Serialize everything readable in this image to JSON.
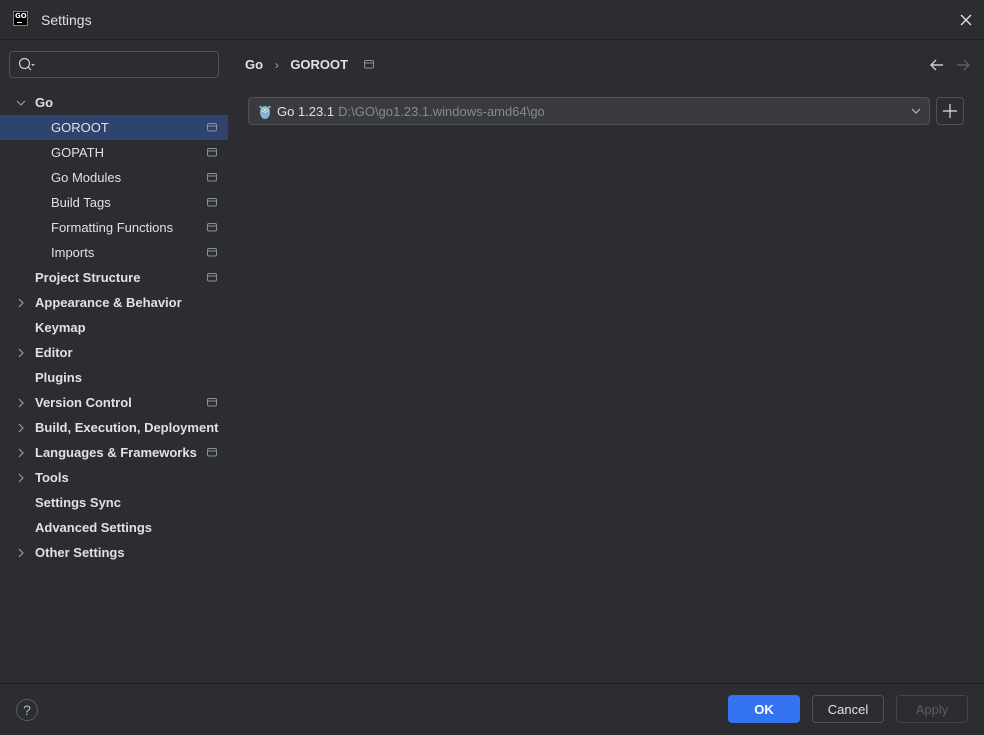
{
  "window": {
    "title": "Settings",
    "logo_text": "GO",
    "icons": {
      "logo": "goland-logo-icon",
      "close": "close-icon"
    }
  },
  "sidebar": {
    "search": {
      "value": "",
      "placeholder": "",
      "icon": "search-icon"
    },
    "items": [
      {
        "label": "Go",
        "level": 0,
        "bold": true,
        "expandable": true,
        "expanded": true,
        "project_icon": false,
        "selected": false
      },
      {
        "label": "GOROOT",
        "level": 1,
        "bold": false,
        "expandable": false,
        "project_icon": true,
        "selected": true
      },
      {
        "label": "GOPATH",
        "level": 1,
        "bold": false,
        "expandable": false,
        "project_icon": true,
        "selected": false
      },
      {
        "label": "Go Modules",
        "level": 1,
        "bold": false,
        "expandable": false,
        "project_icon": true,
        "selected": false
      },
      {
        "label": "Build Tags",
        "level": 1,
        "bold": false,
        "expandable": false,
        "project_icon": true,
        "selected": false
      },
      {
        "label": "Formatting Functions",
        "level": 1,
        "bold": false,
        "expandable": false,
        "project_icon": true,
        "selected": false
      },
      {
        "label": "Imports",
        "level": 1,
        "bold": false,
        "expandable": false,
        "project_icon": true,
        "selected": false
      },
      {
        "label": "Project Structure",
        "level": 0,
        "bold": true,
        "expandable": false,
        "project_icon": true,
        "selected": false
      },
      {
        "label": "Appearance & Behavior",
        "level": 0,
        "bold": true,
        "expandable": true,
        "expanded": false,
        "project_icon": false,
        "selected": false
      },
      {
        "label": "Keymap",
        "level": 0,
        "bold": true,
        "expandable": false,
        "project_icon": false,
        "selected": false
      },
      {
        "label": "Editor",
        "level": 0,
        "bold": true,
        "expandable": true,
        "expanded": false,
        "project_icon": false,
        "selected": false
      },
      {
        "label": "Plugins",
        "level": 0,
        "bold": true,
        "expandable": false,
        "project_icon": false,
        "selected": false
      },
      {
        "label": "Version Control",
        "level": 0,
        "bold": true,
        "expandable": true,
        "expanded": false,
        "project_icon": true,
        "selected": false
      },
      {
        "label": "Build, Execution, Deployment",
        "level": 0,
        "bold": true,
        "expandable": true,
        "expanded": false,
        "project_icon": false,
        "selected": false
      },
      {
        "label": "Languages & Frameworks",
        "level": 0,
        "bold": true,
        "expandable": true,
        "expanded": false,
        "project_icon": true,
        "selected": false
      },
      {
        "label": "Tools",
        "level": 0,
        "bold": true,
        "expandable": true,
        "expanded": false,
        "project_icon": false,
        "selected": false
      },
      {
        "label": "Settings Sync",
        "level": 0,
        "bold": true,
        "expandable": false,
        "project_icon": false,
        "selected": false
      },
      {
        "label": "Advanced Settings",
        "level": 0,
        "bold": true,
        "expandable": false,
        "project_icon": false,
        "selected": false
      },
      {
        "label": "Other Settings",
        "level": 0,
        "bold": true,
        "expandable": true,
        "expanded": false,
        "project_icon": false,
        "selected": false
      }
    ]
  },
  "main": {
    "breadcrumb": {
      "parent": "Go",
      "separator": "›",
      "current": "GOROOT"
    },
    "sdk": {
      "name": "Go 1.23.1",
      "path": "D:\\GO\\go1.23.1.windows-amd64\\go",
      "icon": "gopher-icon"
    },
    "add_button_icon": "plus-icon",
    "nav": {
      "back_icon": "arrow-left-icon",
      "forward_icon": "arrow-right-icon"
    }
  },
  "footer": {
    "help_label": "?",
    "ok_label": "OK",
    "cancel_label": "Cancel",
    "apply_label": "Apply"
  },
  "colors": {
    "background": "#2b2d30",
    "selection": "#2e436e",
    "accent": "#3574f0",
    "text": "#dfe1e5",
    "muted_text": "#868a91"
  }
}
